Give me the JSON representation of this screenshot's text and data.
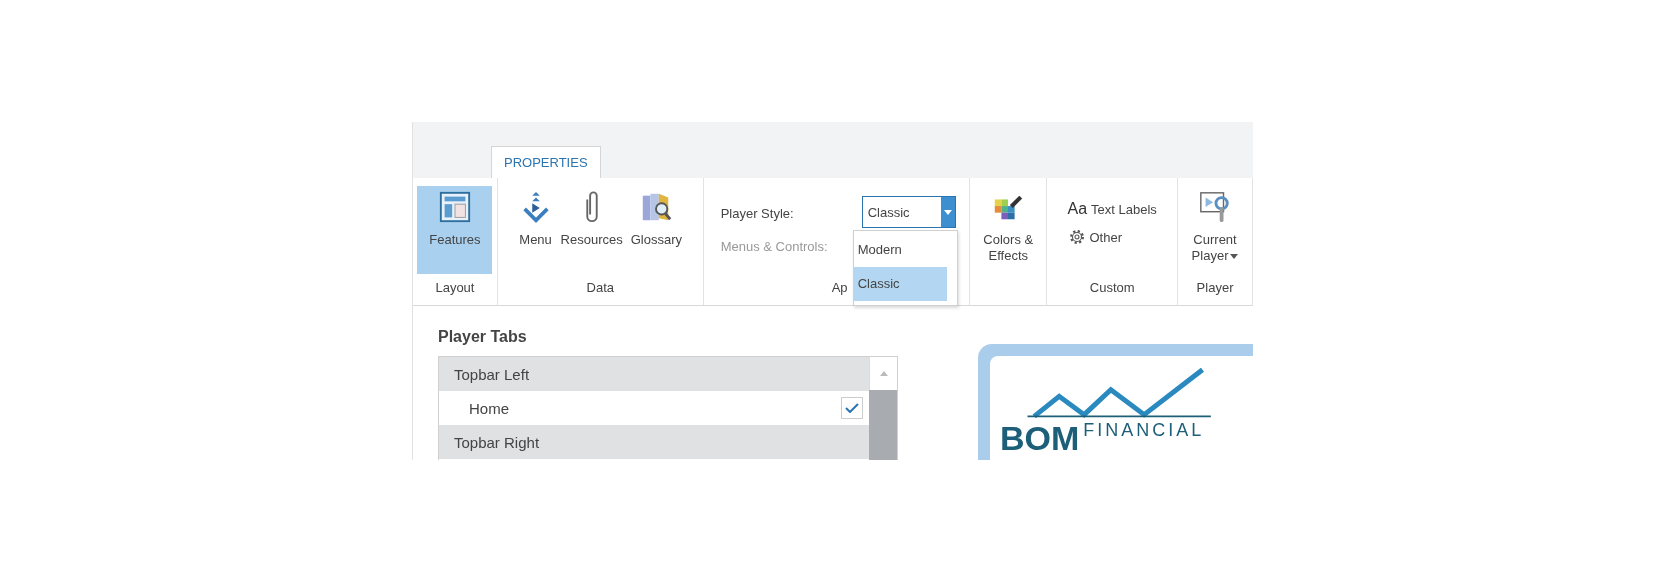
{
  "ribbon": {
    "tabs": [
      {
        "label": "PROPERTIES",
        "selected": true
      }
    ],
    "groups": [
      {
        "kind": "buttons",
        "label": "Layout",
        "buttons": [
          {
            "label": "Features",
            "selected": true,
            "caret": false
          }
        ]
      },
      {
        "kind": "buttons",
        "label": "Data",
        "buttons": [
          {
            "label": "Menu",
            "selected": false,
            "caret": false
          },
          {
            "label": "Resources",
            "selected": false,
            "caret": false
          },
          {
            "label": "Glossary",
            "selected": false,
            "caret": false
          }
        ]
      },
      {
        "kind": "form",
        "label": "Ap",
        "fields": [
          {
            "label": "Player Style:",
            "disabled": false
          },
          {
            "label": "Menus & Controls:",
            "disabled": true
          }
        ],
        "select": {
          "value": "Classic",
          "options": [
            {
              "label": "Modern",
              "selected": false
            },
            {
              "label": "Classic",
              "selected": true
            }
          ]
        }
      },
      {
        "kind": "buttons",
        "buttons": [
          {
            "label": "Colors &\nEffects",
            "selected": false,
            "caret": false
          }
        ]
      },
      {
        "kind": "links",
        "label": "Custom",
        "links": [
          {
            "icon_text": "Aa",
            "label": "Text Labels"
          },
          {
            "label": "Other"
          }
        ]
      },
      {
        "kind": "buttons",
        "label": "Player",
        "buttons": [
          {
            "label": "Current\nPlayer",
            "selected": false,
            "caret": true
          }
        ]
      }
    ]
  },
  "player_tabs": {
    "title": "Player Tabs",
    "items": [
      {
        "kind": "header",
        "label": "Topbar Left"
      },
      {
        "kind": "item",
        "label": "Home",
        "checked": true
      },
      {
        "kind": "header",
        "label": "Topbar Right"
      }
    ]
  },
  "logo_preview": {
    "name": "BOM",
    "subtitle": "FINANCIAL"
  }
}
